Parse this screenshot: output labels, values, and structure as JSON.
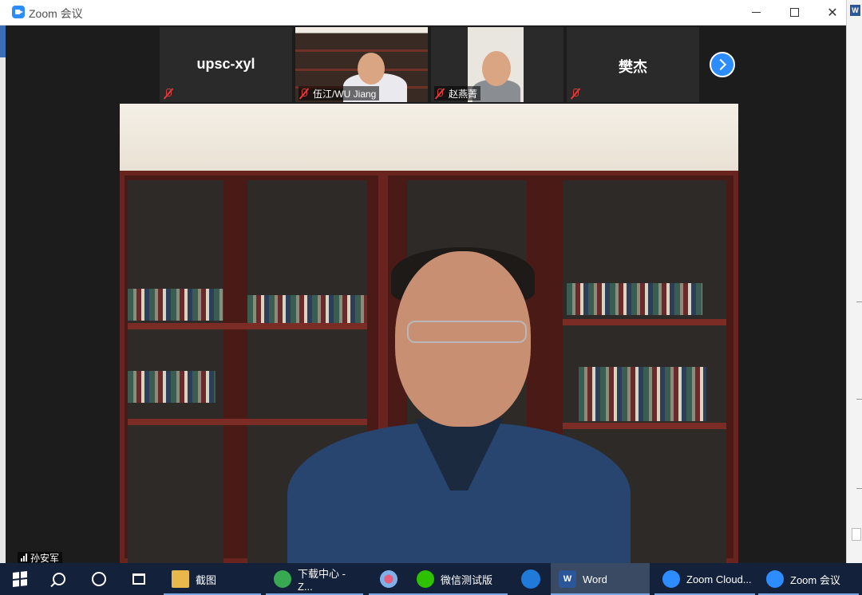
{
  "window": {
    "title": "Zoom 会议"
  },
  "gallery": {
    "tiles": [
      {
        "display_name": "upsc-xyl",
        "label": ""
      },
      {
        "display_name": "",
        "label": "伍江/WU Jiang"
      },
      {
        "display_name": "",
        "label": "赵燕菁"
      },
      {
        "display_name": "樊杰",
        "label": ""
      }
    ]
  },
  "main_speaker": {
    "name": "孙安军"
  },
  "taskbar": {
    "items": [
      {
        "label": "截图",
        "icon": "folder-icon"
      },
      {
        "label": "下载中心 - Z...",
        "icon": "browser-icon"
      },
      {
        "label": "",
        "icon": "flower-app-icon"
      },
      {
        "label": "微信测试版",
        "icon": "wechat-icon"
      },
      {
        "label": "",
        "icon": "edge-icon"
      },
      {
        "label": "Word",
        "icon": "word-icon"
      },
      {
        "label": "Zoom Cloud...",
        "icon": "zoom-icon"
      },
      {
        "label": "Zoom 会议",
        "icon": "zoom-icon"
      }
    ]
  }
}
